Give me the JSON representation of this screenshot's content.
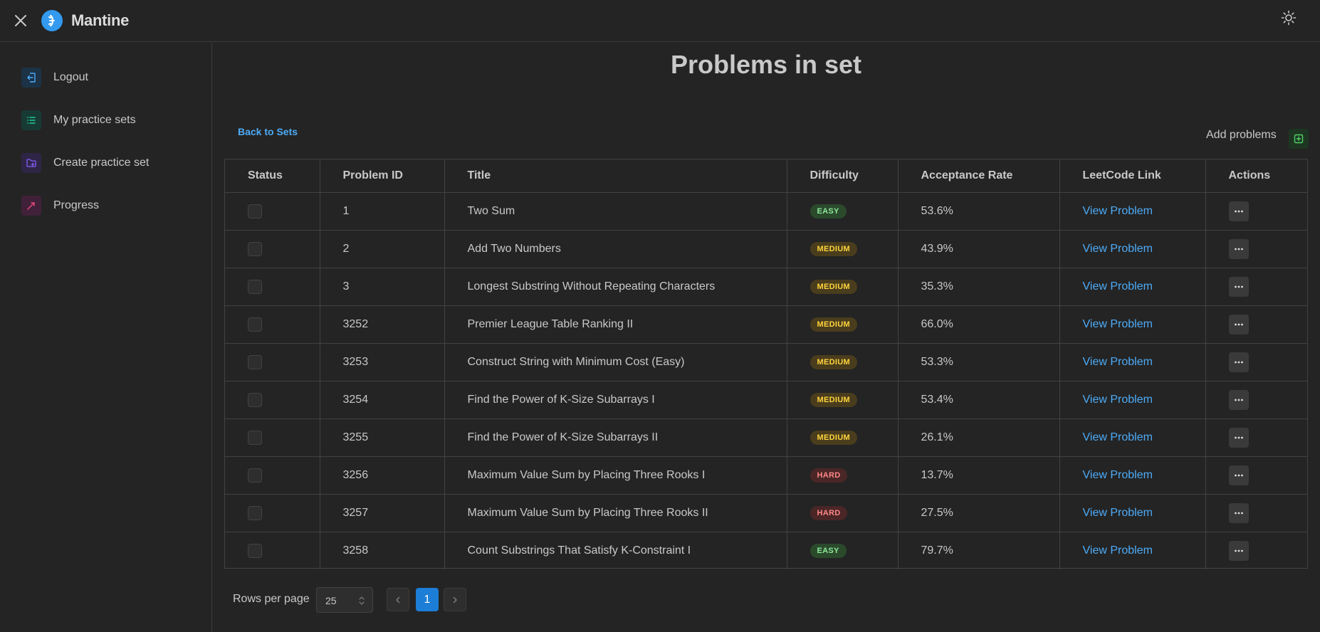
{
  "header": {
    "logo_text": "Mantine"
  },
  "sidebar": {
    "items": [
      {
        "label": "Logout",
        "icon": "logout-icon",
        "color": "#4dabf7"
      },
      {
        "label": "My practice sets",
        "icon": "list-icon",
        "color": "#20c997"
      },
      {
        "label": "Create practice set",
        "icon": "folder-plus-icon",
        "color": "#845ef7"
      },
      {
        "label": "Progress",
        "icon": "trending-up-icon",
        "color": "#e64980"
      }
    ]
  },
  "main": {
    "title": "Problems in set",
    "back_link": "Back to Sets",
    "add_problems_label": "Add problems"
  },
  "table": {
    "headers": [
      "Status",
      "Problem ID",
      "Title",
      "Difficulty",
      "Acceptance Rate",
      "LeetCode Link",
      "Actions"
    ],
    "rows": [
      {
        "id": "1",
        "title": "Two Sum",
        "difficulty": "EASY",
        "rate": "53.6%",
        "link": "View Problem"
      },
      {
        "id": "2",
        "title": "Add Two Numbers",
        "difficulty": "MEDIUM",
        "rate": "43.9%",
        "link": "View Problem"
      },
      {
        "id": "3",
        "title": "Longest Substring Without Repeating Characters",
        "difficulty": "MEDIUM",
        "rate": "35.3%",
        "link": "View Problem"
      },
      {
        "id": "3252",
        "title": "Premier League Table Ranking II",
        "difficulty": "MEDIUM",
        "rate": "66.0%",
        "link": "View Problem"
      },
      {
        "id": "3253",
        "title": "Construct String with Minimum Cost (Easy)",
        "difficulty": "MEDIUM",
        "rate": "53.3%",
        "link": "View Problem"
      },
      {
        "id": "3254",
        "title": "Find the Power of K-Size Subarrays I",
        "difficulty": "MEDIUM",
        "rate": "53.4%",
        "link": "View Problem"
      },
      {
        "id": "3255",
        "title": "Find the Power of K-Size Subarrays II",
        "difficulty": "MEDIUM",
        "rate": "26.1%",
        "link": "View Problem"
      },
      {
        "id": "3256",
        "title": "Maximum Value Sum by Placing Three Rooks I",
        "difficulty": "HARD",
        "rate": "13.7%",
        "link": "View Problem"
      },
      {
        "id": "3257",
        "title": "Maximum Value Sum by Placing Three Rooks II",
        "difficulty": "HARD",
        "rate": "27.5%",
        "link": "View Problem"
      },
      {
        "id": "3258",
        "title": "Count Substrings That Satisfy K-Constraint I",
        "difficulty": "EASY",
        "rate": "79.7%",
        "link": "View Problem"
      }
    ]
  },
  "pagination": {
    "rows_per_page_label": "Rows per page",
    "rows_per_page_value": "25",
    "current_page": "1"
  }
}
